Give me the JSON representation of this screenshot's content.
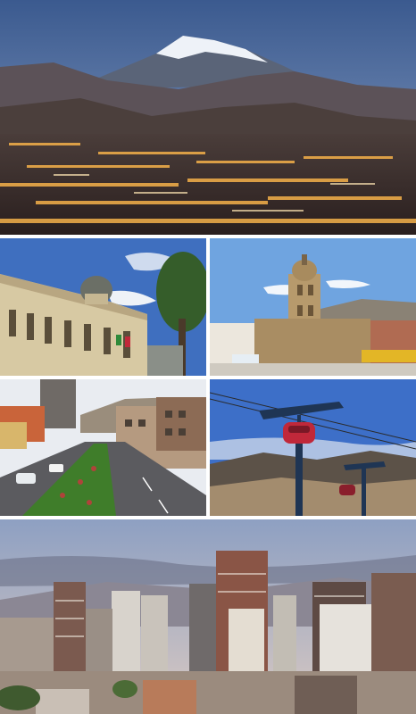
{
  "collage": {
    "panels": [
      {
        "id": "panorama",
        "subject": "city-at-dusk-below-snow-capped-mountain"
      },
      {
        "id": "palace",
        "subject": "neoclassical-government-palace-with-dome"
      },
      {
        "id": "church",
        "subject": "stone-colonial-church-with-bell-tower"
      },
      {
        "id": "avenue",
        "subject": "tree-lined-avenue-with-planted-median"
      },
      {
        "id": "cablecar",
        "subject": "cable-car-tower-with-red-gondola"
      },
      {
        "id": "skyline",
        "subject": "downtown-high-rise-skyline"
      }
    ],
    "colors": {
      "sky_top": "#3b5a8f",
      "mountain_snow": "#eef2f8",
      "city_lights": "#f5b14a",
      "gondola_red": "#c0283a",
      "median_green": "#3f7d2a"
    }
  }
}
